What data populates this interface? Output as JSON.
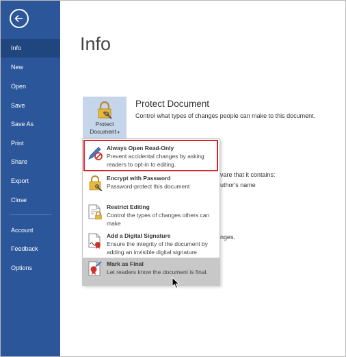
{
  "sidebar": {
    "back_label": "Back",
    "items": [
      {
        "label": "Info",
        "active": true
      },
      {
        "label": "New"
      },
      {
        "label": "Open"
      },
      {
        "label": "Save"
      },
      {
        "label": "Save As"
      },
      {
        "label": "Print"
      },
      {
        "label": "Share"
      },
      {
        "label": "Export"
      },
      {
        "label": "Close"
      },
      {
        "label": "Account"
      },
      {
        "label": "Feedback"
      },
      {
        "label": "Options"
      }
    ]
  },
  "main": {
    "title": "Info",
    "protect_button": {
      "line1": "Protect",
      "line2": "Document"
    },
    "protect_section": {
      "title": "Protect Document",
      "description": "Control what types of changes people can make to this document."
    },
    "partial_text": {
      "line1": "vare that it contains:",
      "line2": "uthor's name",
      "line3": "nges."
    }
  },
  "menu": {
    "items": [
      {
        "title": "Always Open Read-Only",
        "description": "Prevent accidental changes by asking readers to opt-in to editing.",
        "icon": "read-only-pen-icon"
      },
      {
        "title": "Encrypt with Password",
        "description": "Password-protect this document",
        "icon": "lock-key-icon"
      },
      {
        "title": "Restrict Editing",
        "description": "Control the types of changes others can make",
        "icon": "restrict-editing-icon"
      },
      {
        "title": "Add a Digital Signature",
        "description": "Ensure the integrity of the document by adding an invisible digital signature",
        "icon": "digital-signature-icon"
      },
      {
        "title": "Mark as Final",
        "description": "Let readers know the document is final.",
        "icon": "mark-final-icon",
        "hovered": true
      }
    ]
  },
  "colors": {
    "sidebar": "#2b579a",
    "sidebar_active": "#1f467e",
    "highlight": "#d9232e",
    "protect_button_bg": "#c5d5ea",
    "hover_bg": "#c8c8c8"
  }
}
